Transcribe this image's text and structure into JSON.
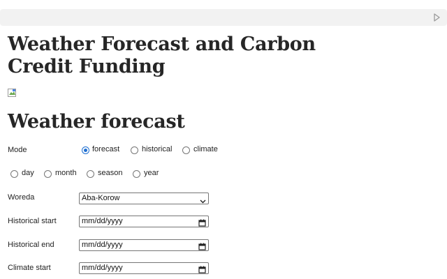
{
  "page": {
    "title": "Weather Forecast and Carbon Credit Funding",
    "image_alt": ""
  },
  "section": {
    "heading": "Weather forecast"
  },
  "mode": {
    "label": "Mode",
    "options": [
      "forecast",
      "historical",
      "climate"
    ],
    "selected": "forecast"
  },
  "period": {
    "options": [
      "day",
      "month",
      "season",
      "year"
    ],
    "selected": ""
  },
  "woreda": {
    "label": "Woreda",
    "value": "Aba-Korow"
  },
  "historical_start": {
    "label": "Historical start",
    "value": "mm/dd/yyyy"
  },
  "historical_end": {
    "label": "Historical end",
    "value": "mm/dd/yyyy"
  },
  "climate_start": {
    "label": "Climate start",
    "value": "mm/dd/yyyy"
  },
  "colors": {
    "accent": "#1f6fd1",
    "heading": "#262626",
    "topbar": "#f2f2f2"
  },
  "icons": {
    "run": "play-icon",
    "broken_image": "broken-image-icon",
    "dropdown": "chevron-down-icon",
    "calendar": "calendar-icon"
  }
}
